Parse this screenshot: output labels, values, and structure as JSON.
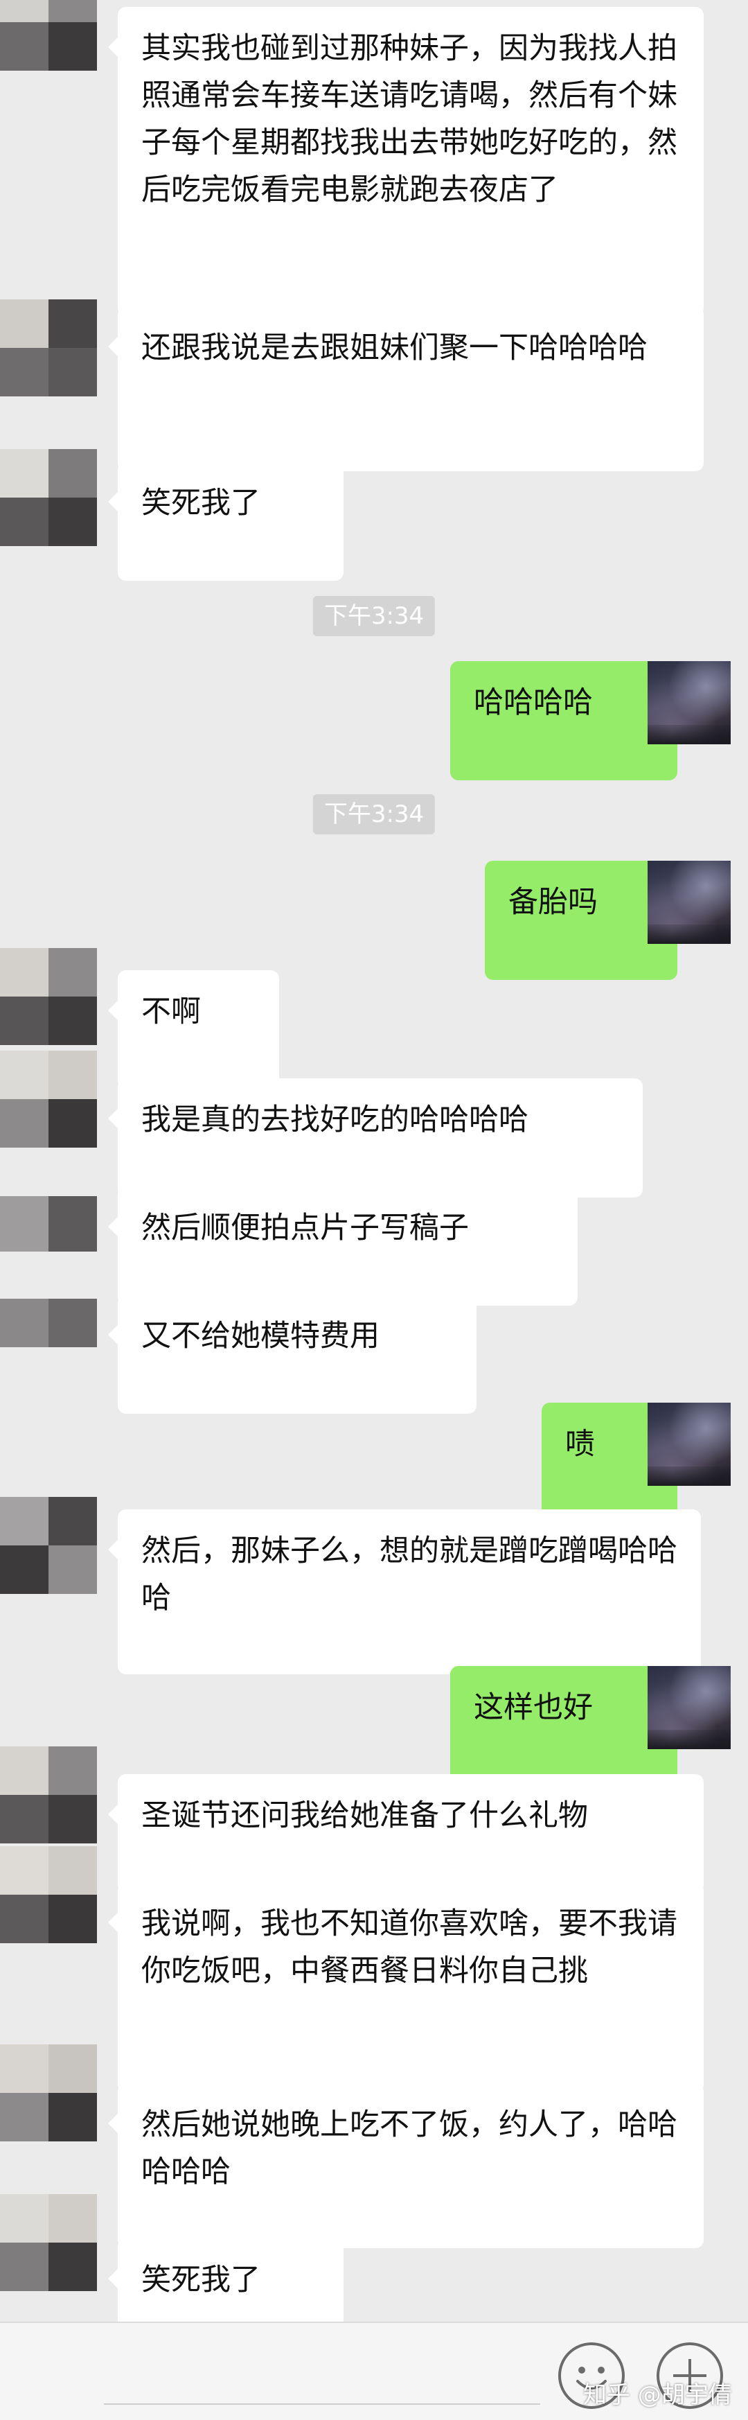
{
  "messages": [
    {
      "from": "other",
      "text": "其实我也碰到过那种妹子，因为我找人拍照通常会车接车送请吃请喝，然后有个妹子每个星期都找我出去带她吃好吃的，然后吃完饭看完电影就跑去夜店了"
    },
    {
      "from": "other",
      "text": "还跟我说是去跟姐妹们聚一下哈哈哈哈"
    },
    {
      "from": "other",
      "text": "笑死我了"
    },
    {
      "type": "time",
      "text": "下午3:34"
    },
    {
      "from": "self",
      "text": "哈哈哈哈"
    },
    {
      "type": "time",
      "text": "下午3:34"
    },
    {
      "from": "self",
      "text": "备胎吗"
    },
    {
      "from": "other",
      "text": "不啊"
    },
    {
      "from": "other",
      "text": "我是真的去找好吃的哈哈哈哈"
    },
    {
      "from": "other",
      "text": "然后顺便拍点片子写稿子"
    },
    {
      "from": "other",
      "text": "又不给她模特费用"
    },
    {
      "from": "self",
      "text": "啧"
    },
    {
      "from": "other",
      "text": "然后，那妹子么，想的就是蹭吃蹭喝哈哈哈"
    },
    {
      "from": "self",
      "text": "这样也好"
    },
    {
      "from": "other",
      "text": "圣诞节还问我给她准备了什么礼物"
    },
    {
      "from": "other",
      "text": "我说啊，我也不知道你喜欢啥，要不我请你吃饭吧，中餐西餐日料你自己挑"
    },
    {
      "from": "other",
      "text": "然后她说她晚上吃不了饭，约人了，哈哈哈哈哈"
    },
    {
      "from": "other",
      "text": "笑死我了"
    }
  ],
  "bottom_bar": {
    "emoji_icon": "emoji-icon",
    "plus_icon": "plus-icon"
  },
  "watermark": "知乎 @胡宇倩",
  "colors": {
    "background": "#ebebeb",
    "self_bubble": "#95ec69",
    "other_bubble": "#ffffff",
    "time_badge": "#d4d4d4"
  }
}
